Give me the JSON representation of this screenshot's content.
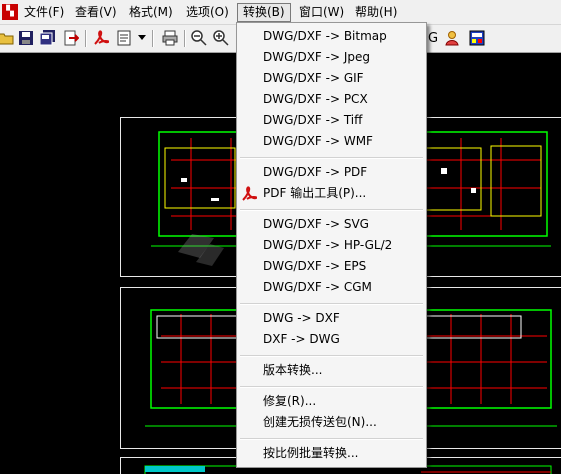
{
  "menubar": {
    "items": [
      "文件(F)",
      "查看(V)",
      "格式(M)",
      "选项(O)",
      "转换(B)",
      "窗口(W)",
      "帮助(H)"
    ],
    "active_index": 4
  },
  "toolbar": {
    "icons": [
      "open-folder-icon",
      "save-icon",
      "save-all-icon",
      "export-icon",
      "pdf-acrobat-icon",
      "print-setup-icon",
      "dropdown-arrow-icon",
      "print-icon",
      "zoom-out-icon",
      "zoom-in-icon"
    ],
    "right_text": "G"
  },
  "convert_menu": {
    "groups": [
      [
        "DWG/DXF -> Bitmap",
        "DWG/DXF -> Jpeg",
        "DWG/DXF -> GIF",
        "DWG/DXF -> PCX",
        "DWG/DXF -> Tiff",
        "DWG/DXF -> WMF"
      ],
      [
        "DWG/DXF -> PDF",
        "PDF 输出工具(P)..."
      ],
      [
        "DWG/DXF -> SVG",
        "DWG/DXF -> HP-GL/2",
        "DWG/DXF -> EPS",
        "DWG/DXF -> CGM"
      ],
      [
        "DWG -> DXF",
        "DXF -> DWG"
      ],
      [
        "版本转换..."
      ],
      [
        "修复(R)...",
        "创建无损传送包(N)..."
      ],
      [
        "按比例批量转换..."
      ]
    ],
    "pdf_tool_icon": "pdf-acrobat-icon"
  },
  "colors": {
    "menu_bg": "#f5f5f5",
    "canvas_bg": "#000000",
    "drawing_green": "#00ff00",
    "drawing_red": "#ff0000",
    "drawing_yellow": "#ffff00",
    "drawing_white": "#ffffff"
  }
}
